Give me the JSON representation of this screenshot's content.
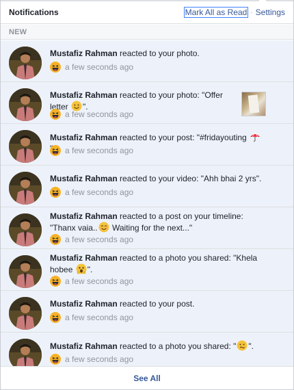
{
  "header": {
    "title": "Notifications",
    "mark_all_read": "Mark All as Read",
    "separator": "·",
    "settings": "Settings"
  },
  "section_label": "NEW",
  "colors": {
    "unread_bg": "#edf2fa",
    "link": "#365899",
    "meta_text": "#90949c"
  },
  "notifications": [
    {
      "actor": "Mustafiz Rahman",
      "text": " reacted to your photo.",
      "reaction_icon": "haha-reaction-icon",
      "time": "a few seconds ago"
    },
    {
      "actor": "Mustafiz Rahman",
      "text": " reacted to your photo: \"Offer letter ",
      "inline_emoji": "smile-emoji",
      "text_after": "\".",
      "reaction_icon": "haha-reaction-icon",
      "time": "a few seconds ago",
      "thumbnail": "photo-thumbnail"
    },
    {
      "actor": "Mustafiz Rahman",
      "text": " reacted to your post: \"#fridayouting ",
      "inline_emoji": "umbrella-emoji",
      "text_after": "\".",
      "reaction_icon": "haha-reaction-icon",
      "time": "a few seconds ago"
    },
    {
      "actor": "Mustafiz Rahman",
      "text": " reacted to your video: \"Ahh bhai 2 yrs\".",
      "reaction_icon": "haha-reaction-icon",
      "time": "a few seconds ago"
    },
    {
      "actor": "Mustafiz Rahman",
      "text": " reacted to a post on your timeline: \"Thanx vaia..",
      "inline_emoji": "smile-emoji",
      "text_after": " Waiting for the next...\"",
      "reaction_icon": "haha-reaction-icon",
      "time": "a few seconds ago"
    },
    {
      "actor": "Mustafiz Rahman",
      "text": " reacted to a photo you shared: \"Khela hobee ",
      "inline_emoji": "fearful-emoji",
      "text_after": "\".",
      "reaction_icon": "haha-reaction-icon",
      "time": "a few seconds ago"
    },
    {
      "actor": "Mustafiz Rahman",
      "text": " reacted to your post.",
      "reaction_icon": "haha-reaction-icon",
      "time": "a few seconds ago"
    },
    {
      "actor": "Mustafiz Rahman",
      "text": " reacted to a photo you shared: \"",
      "inline_emoji": "confused-emoji",
      "text_after": "\".",
      "reaction_icon": "haha-reaction-icon",
      "time": "a few seconds ago"
    }
  ],
  "footer": {
    "see_all": "See All"
  }
}
